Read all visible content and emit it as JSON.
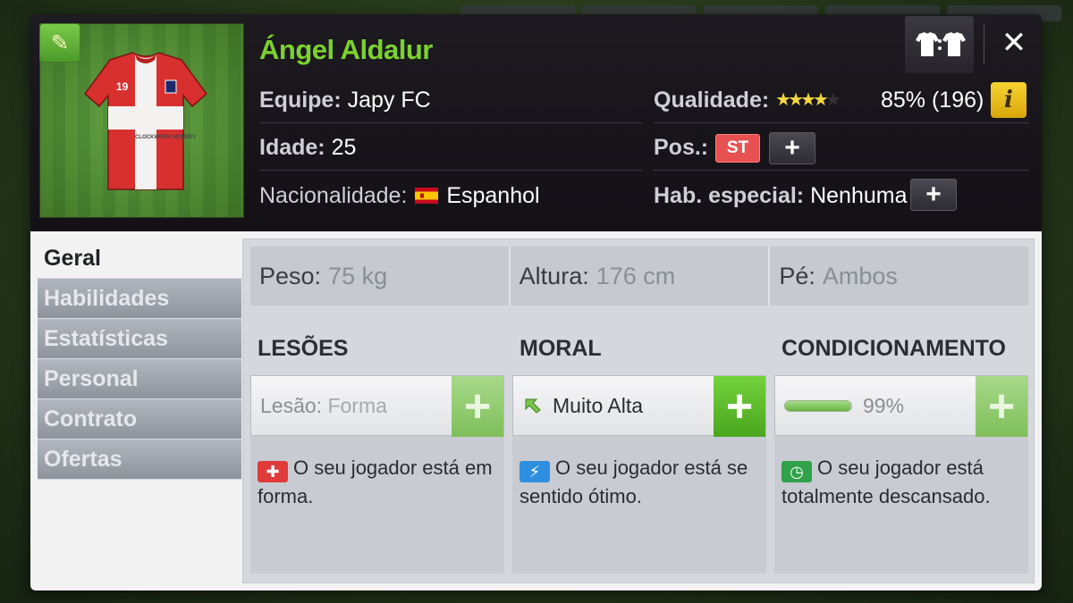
{
  "player": {
    "name": "Ángel Aldalur",
    "jersey_number": "19",
    "sponsor": "CLOCKWORK MONKEY"
  },
  "info": {
    "team_label": "Equipe:",
    "team": "Japy FC",
    "age_label": "Idade:",
    "age": "25",
    "nationality_label": "Nacionalidade:",
    "nationality": "Espanhol",
    "quality_label": "Qualidade:",
    "quality_stars": 4,
    "quality_max": 5,
    "quality_value": "85% (196)",
    "position_label": "Pos.:",
    "position": "ST",
    "special_label": "Hab. especial:",
    "special": "Nenhuma"
  },
  "buttons": {
    "kit": "T:T",
    "close": "✕",
    "info": "i",
    "plus": "+"
  },
  "sidebar": {
    "items": [
      {
        "label": "Geral",
        "active": true
      },
      {
        "label": "Habilidades"
      },
      {
        "label": "Estatísticas"
      },
      {
        "label": "Personal"
      },
      {
        "label": "Contrato"
      },
      {
        "label": "Ofertas"
      }
    ]
  },
  "attributes": {
    "weight_label": "Peso:",
    "weight": "75 kg",
    "height_label": "Altura:",
    "height": "176 cm",
    "foot_label": "Pé:",
    "foot": "Ambos"
  },
  "panels": {
    "injuries": {
      "title": "LESÕES",
      "status_label": "Lesão:",
      "status_value": "Forma",
      "description": "O seu jogador está em forma."
    },
    "morale": {
      "title": "MORAL",
      "status_value": "Muito Alta",
      "description": "O seu jogador está se sentido ótimo."
    },
    "conditioning": {
      "title": "CONDICIONAMENTO",
      "percent_text": "99%",
      "percent": 0.99,
      "description": "O seu jogador está totalmente descansado."
    }
  },
  "colors": {
    "name_green": "#7bd22e",
    "position_red": "#e85151",
    "info_yellow": "#f2c21a",
    "plus_green": "#5bb82a"
  }
}
